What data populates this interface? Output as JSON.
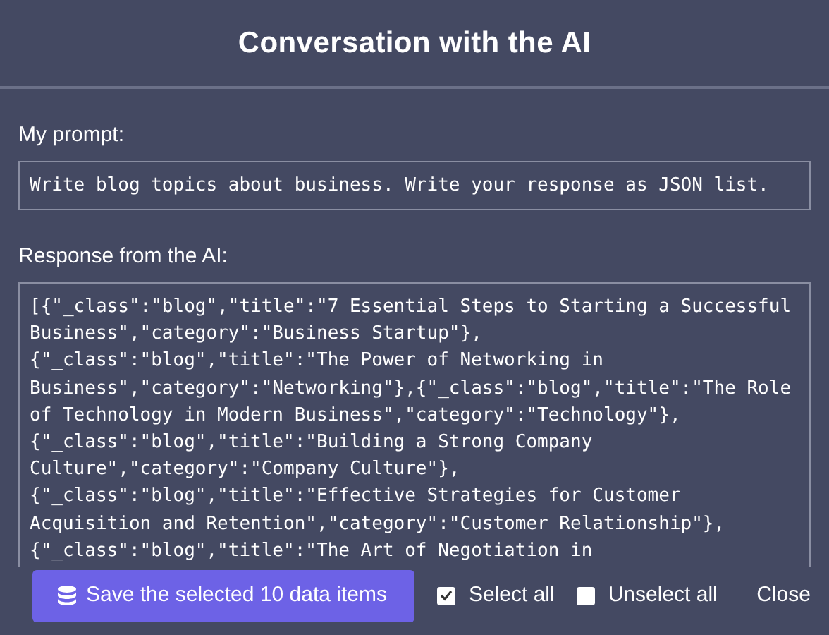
{
  "dialog": {
    "title": "Conversation with the AI"
  },
  "prompt": {
    "label": "My prompt:",
    "value": "Write blog topics about business. Write your response as JSON list."
  },
  "response": {
    "label": "Response from the AI:",
    "value": "[{\"_class\":\"blog\",\"title\":\"7 Essential Steps to Starting a Successful\nBusiness\",\"category\":\"Business Startup\"},\n{\"_class\":\"blog\",\"title\":\"The Power of Networking in\nBusiness\",\"category\":\"Networking\"},{\"_class\":\"blog\",\"title\":\"The Role\nof Technology in Modern Business\",\"category\":\"Technology\"},\n{\"_class\":\"blog\",\"title\":\"Building a Strong Company\nCulture\",\"category\":\"Company Culture\"},\n{\"_class\":\"blog\",\"title\":\"Effective Strategies for Customer\nAcquisition and Retention\",\"category\":\"Customer Relationship\"},\n{\"_class\":\"blog\",\"title\":\"The Art of Negotiation in"
  },
  "footer": {
    "save_button": "Save the selected 10 data items",
    "checkboxes": [
      {
        "label": "Select all",
        "checked": true
      },
      {
        "label": "Unselect all",
        "checked": false
      }
    ],
    "close": "Close"
  }
}
